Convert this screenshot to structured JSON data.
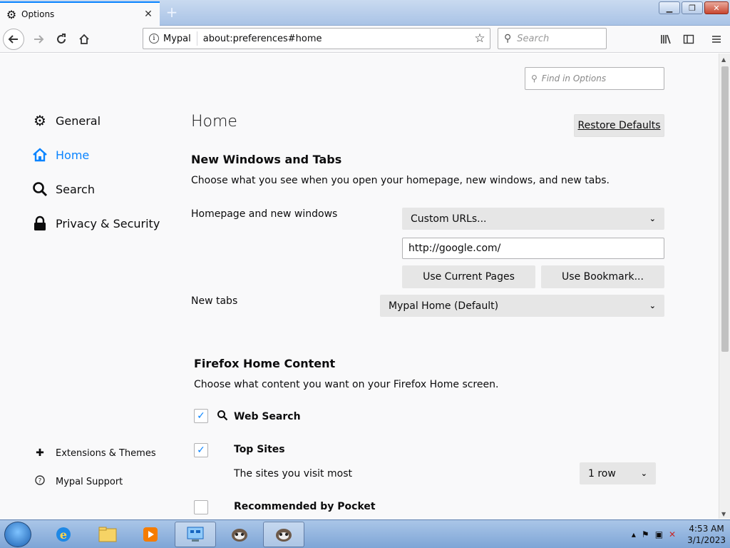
{
  "tab": {
    "title": "Options",
    "icon": "gear-icon"
  },
  "navbar": {
    "identity": "Mypal",
    "url": "about:preferences#home",
    "search_placeholder": "Search"
  },
  "find": {
    "placeholder": "Find in Options"
  },
  "sidebar": {
    "items": [
      {
        "label": "General",
        "icon": "gear-icon",
        "selected": false
      },
      {
        "label": "Home",
        "icon": "home-icon",
        "selected": true
      },
      {
        "label": "Search",
        "icon": "search-icon",
        "selected": false
      },
      {
        "label": "Privacy & Security",
        "icon": "lock-icon",
        "selected": false
      }
    ],
    "footer": [
      {
        "label": "Extensions & Themes",
        "icon": "puzzle-icon"
      },
      {
        "label": "Mypal Support",
        "icon": "help-icon"
      }
    ]
  },
  "main": {
    "title": "Home",
    "restore_label": "Restore Defaults",
    "section1": {
      "heading": "New Windows and Tabs",
      "description": "Choose what you see when you open your homepage, new windows, and new tabs.",
      "homepage_label": "Homepage and new windows",
      "homepage_select": "Custom URLs...",
      "homepage_url": "http://google.com/",
      "use_current_label": "Use Current Pages",
      "use_bookmark_label": "Use Bookmark...",
      "newtabs_label": "New tabs",
      "newtabs_select": "Mypal Home (Default)"
    },
    "section2": {
      "heading": "Firefox Home Content",
      "description": "Choose what content you want on your Firefox Home screen.",
      "options": [
        {
          "label": "Web Search",
          "checked": true,
          "icon": "search-icon"
        },
        {
          "label": "Top Sites",
          "checked": true
        },
        {
          "label": "Recommended by Pocket",
          "checked": false
        }
      ],
      "topsites_desc": "The sites you visit most",
      "topsites_rows": "1 row"
    }
  },
  "taskbar": {
    "time": "4:53 AM",
    "date": "3/1/2023"
  },
  "colors": {
    "accent": "#0a84ff"
  }
}
